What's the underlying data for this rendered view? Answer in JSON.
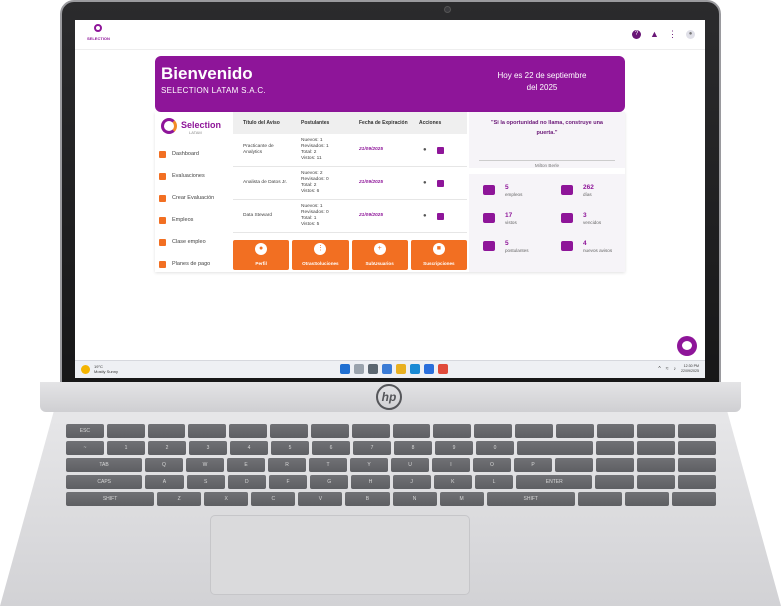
{
  "app": {
    "logo_word": "SELECTION",
    "top_icons": [
      "help-icon",
      "bell-icon",
      "apps-grid-icon",
      "user-avatar-icon"
    ]
  },
  "banner": {
    "title": "Bienvenido",
    "company": "SELECTION LATAM S.A.C.",
    "date_text": "Hoy es 22 de septiembre del 2025"
  },
  "sidebar": {
    "brand": "Selection",
    "brand_sub": "LATAM",
    "items": [
      {
        "label": "Dashboard",
        "icon": "dashboard-icon"
      },
      {
        "label": "Evaluaciones",
        "icon": "evaluations-icon"
      },
      {
        "label": "Crear Evaluación",
        "icon": "create-evaluation-icon"
      },
      {
        "label": "Empleos",
        "icon": "jobs-icon"
      },
      {
        "label": "Clase empleo",
        "icon": "job-class-icon"
      },
      {
        "label": "Planes de pago",
        "icon": "payment-plans-icon"
      }
    ]
  },
  "table": {
    "headers": [
      "Título del Aviso",
      "Postulantes",
      "Fecha de Expiración",
      "Acciones"
    ],
    "rows": [
      {
        "title": "Practicante de Analytics",
        "applicants": [
          "Nuevos: 1",
          "Revisados: 1",
          "Total: 2",
          "Vistos: 11"
        ],
        "expires": "21/09/2025"
      },
      {
        "title": "Analista de Datos Jr.",
        "applicants": [
          "Nuevos: 2",
          "Revisados: 0",
          "Total: 2",
          "Vistos: 6"
        ],
        "expires": "21/09/2025"
      },
      {
        "title": "Data Steward",
        "applicants": [
          "Nuevos: 1",
          "Revisados: 0",
          "Total: 1",
          "Vistos: 5"
        ],
        "expires": "21/09/2025"
      }
    ]
  },
  "tiles": [
    {
      "label": "Perfil",
      "icon": "profile-icon"
    },
    {
      "label": "OtrasSoluciones",
      "icon": "solutions-grid-icon"
    },
    {
      "label": "SubUsuarios",
      "icon": "subusers-icon"
    },
    {
      "label": "Suscripciones",
      "icon": "card-icon"
    }
  ],
  "quote": {
    "text": "\"Si la oportunidad no llama, construye una puerta.\"",
    "author": "Milton Berle"
  },
  "stats": [
    {
      "value": "5",
      "label": "empleos",
      "icon": "briefcase-icon"
    },
    {
      "value": "262",
      "label": "días",
      "icon": "calendar-icon"
    },
    {
      "value": "17",
      "label": "vistos",
      "icon": "eye-icon"
    },
    {
      "value": "3",
      "label": "vencidos",
      "icon": "expired-briefcase-icon"
    },
    {
      "value": "5",
      "label": "postulantes",
      "icon": "applicants-icon"
    },
    {
      "value": "4",
      "label": "nuevos avisos",
      "icon": "new-jobs-icon"
    }
  ],
  "taskbar": {
    "weather_temp": "19°C",
    "weather_desc": "Mostly Sunny",
    "time": "12:30 PM",
    "date": "22/09/2025"
  },
  "device": {
    "brand": "hp"
  }
}
